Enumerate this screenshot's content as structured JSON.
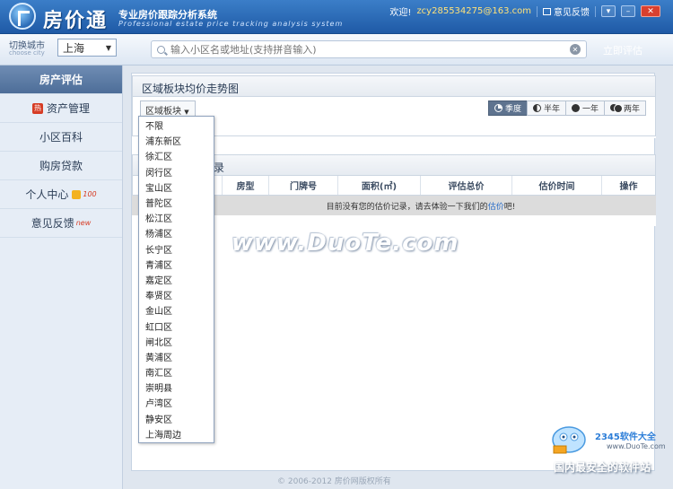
{
  "app": {
    "name": "房价通",
    "slogan_cn": "专业房价跟踪分析系统",
    "slogan_en": "Professional estate price tracking analysis system"
  },
  "titlebar": {
    "welcome": "欢迎!",
    "email": "zcy285534275@163.com",
    "feedback": "意见反馈"
  },
  "city": {
    "label": "切换城市",
    "label_en": "choose city",
    "selected": "上海"
  },
  "search": {
    "placeholder": "输入小区名或地址(支持拼音输入)",
    "action": "立即评估"
  },
  "sidebar": {
    "items": [
      {
        "label": "房产评估",
        "active": true
      },
      {
        "label": "资产管理",
        "icon": "hot-icon",
        "icon_text": "热"
      },
      {
        "label": "小区百科"
      },
      {
        "label": "购房贷款"
      },
      {
        "label": "个人中心",
        "badge": "100"
      },
      {
        "label": "意见反馈",
        "badge": "new"
      }
    ]
  },
  "trend": {
    "title": "区域板块均价走势图",
    "region_dropdown": "区域板块",
    "periods": [
      {
        "label": "季度",
        "active": true
      },
      {
        "label": "半年"
      },
      {
        "label": "一年"
      },
      {
        "label": "两年"
      }
    ]
  },
  "records": {
    "title_suffix": "录",
    "columns": [
      "房型",
      "门牌号",
      "面积(㎡)",
      "评估总价",
      "估价时间",
      "操作"
    ],
    "empty_text": "目前没有您的估价记录，请去体验一下我们的",
    "empty_link": "估价",
    "empty_end": "吧!"
  },
  "region_options": [
    "不限",
    "浦东新区",
    "徐汇区",
    "闵行区",
    "宝山区",
    "普陀区",
    "松江区",
    "杨浦区",
    "长宁区",
    "青浦区",
    "嘉定区",
    "奉贤区",
    "金山区",
    "虹口区",
    "闸北区",
    "黄浦区",
    "南汇区",
    "崇明县",
    "卢湾区",
    "静安区",
    "上海周边"
  ],
  "watermarks": {
    "duote": "www.DuoTe.com",
    "site_2345": "2345软件大全",
    "site_url": "www.DuoTe.com",
    "tagline": "国内最安全的软件站"
  },
  "footer": {
    "copyright": "© 2006-2012 房价网版权所有"
  }
}
